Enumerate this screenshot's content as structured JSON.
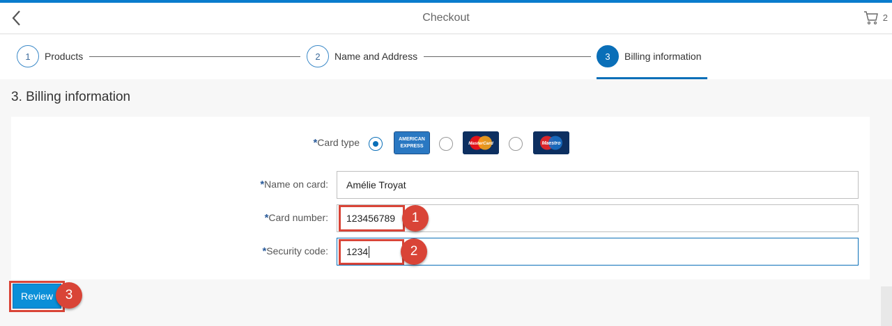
{
  "header": {
    "title": "Checkout",
    "cart_count": "2"
  },
  "wizard": {
    "steps": [
      {
        "number": "1",
        "label": "Products"
      },
      {
        "number": "2",
        "label": "Name and Address"
      },
      {
        "number": "3",
        "label": "Billing information",
        "active": true
      }
    ]
  },
  "section": {
    "title": "3. Billing information"
  },
  "form": {
    "required_mark": "*",
    "card_type": {
      "label": "Card type",
      "options": [
        {
          "name": "American Express",
          "logo_text": "AMERICAN EXPRESS",
          "selected": true
        },
        {
          "name": "MasterCard",
          "logo_text": "MasterCard",
          "selected": false
        },
        {
          "name": "Maestro",
          "logo_text": "Maestro",
          "selected": false
        }
      ]
    },
    "name_on_card": {
      "label": "Name on card:",
      "value": "Amélie Troyat"
    },
    "card_number": {
      "label": "Card number:",
      "value": "123456789"
    },
    "security_code": {
      "label": "Security code:",
      "value": "1234"
    }
  },
  "actions": {
    "review_label": "Review"
  },
  "annotations": [
    "1",
    "2",
    "3"
  ],
  "colors": {
    "accent": "#0a6fb8",
    "callout": "#d94437",
    "button": "#0a8fd8"
  }
}
